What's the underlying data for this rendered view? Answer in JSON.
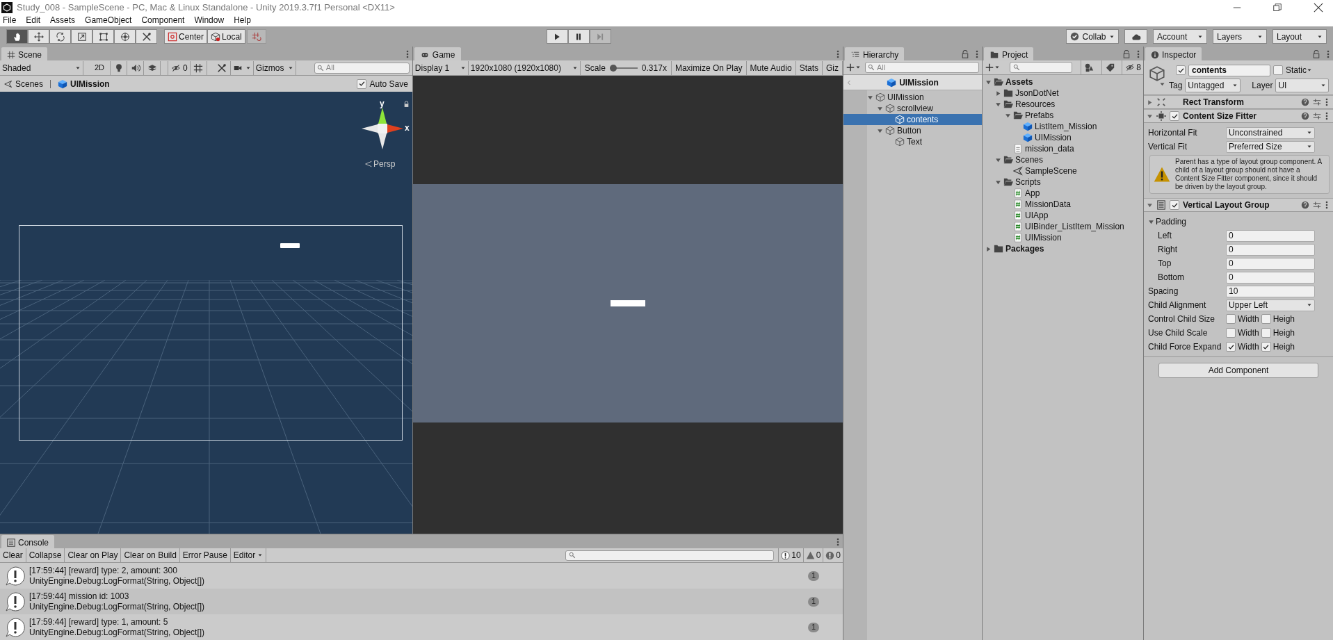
{
  "title_bar": {
    "title": "Study_008 - SampleScene - PC, Mac & Linux Standalone - Unity 2019.3.7f1 Personal <DX11>"
  },
  "menu_bar": [
    "File",
    "Edit",
    "Assets",
    "GameObject",
    "Component",
    "Window",
    "Help"
  ],
  "toolbar": {
    "tools": [
      {
        "kind": "hand",
        "selected": true
      },
      {
        "kind": "move",
        "selected": false
      },
      {
        "kind": "rotate",
        "selected": false
      },
      {
        "kind": "scale",
        "selected": false
      },
      {
        "kind": "rect",
        "selected": false
      },
      {
        "kind": "transform",
        "selected": false
      },
      {
        "kind": "custom",
        "selected": false
      }
    ],
    "pivot_buttons": [
      {
        "kind": "center",
        "label": "Center"
      },
      {
        "kind": "local",
        "label": "Local"
      }
    ],
    "play_controls": [
      {
        "kind": "play",
        "disabled": false
      },
      {
        "kind": "pause",
        "disabled": false
      },
      {
        "kind": "step",
        "disabled": true
      }
    ],
    "right_buttons": [
      {
        "kind": "collab",
        "label": "Collab"
      },
      {
        "kind": "cloud"
      },
      {
        "kind": "dropdown",
        "label": "Account"
      },
      {
        "kind": "dropdown",
        "label": "Layers"
      },
      {
        "kind": "dropdown",
        "label": "Layout"
      }
    ]
  },
  "scene_panel": {
    "tab": "Scene",
    "toolbar": {
      "shading": "Shaded",
      "mode_2d": "2D",
      "hidden_count": "0",
      "gizmos": "Gizmos",
      "search_placeholder": "All"
    },
    "breadcrumbs": [
      {
        "kind": "scenes",
        "label": "Scenes"
      },
      {
        "kind": "prefab",
        "label": "UIMission"
      }
    ],
    "auto_save": {
      "label": "Auto Save",
      "checked": true
    },
    "view": {
      "axis_y": "y",
      "axis_x": "x",
      "projection": "Persp"
    }
  },
  "game_panel": {
    "tab": "Game",
    "toolbar": {
      "display": "Display 1",
      "resolution": "1920x1080 (1920x1080)",
      "scale_label": "Scale",
      "scale": {
        "level": 0.12
      },
      "scale_reading": "0.317x",
      "buttons": [
        "Maximize On Play",
        "Mute Audio",
        "Stats",
        "Giz"
      ]
    }
  },
  "hierarchy": {
    "tab": "Hierarchy",
    "search_placeholder": "All",
    "header": "UIMission",
    "tree": [
      {
        "label": "UIMission",
        "expanded": true,
        "selected": false,
        "children": [
          {
            "label": "scrollview",
            "expanded": true,
            "selected": false,
            "children": [
              {
                "label": "contents",
                "selected": true
              }
            ]
          },
          {
            "label": "Button",
            "expanded": true,
            "selected": false,
            "children": [
              {
                "label": "Text",
                "selected": false
              }
            ]
          }
        ]
      }
    ]
  },
  "project": {
    "tab": "Project",
    "hidden_count": "8",
    "tree": [
      {
        "kind": "folder",
        "label": "Assets",
        "expanded": true,
        "children": [
          {
            "kind": "folder",
            "label": "JsonDotNet",
            "expanded": false
          },
          {
            "kind": "folder",
            "label": "Resources",
            "expanded": true,
            "children": [
              {
                "kind": "folder",
                "label": "Prefabs",
                "expanded": true,
                "children": [
                  {
                    "kind": "prefab",
                    "label": "ListItem_Mission"
                  },
                  {
                    "kind": "prefab",
                    "label": "UIMission"
                  }
                ]
              },
              {
                "kind": "text",
                "label": "mission_data"
              }
            ]
          },
          {
            "kind": "folder",
            "label": "Scenes",
            "expanded": true,
            "children": [
              {
                "kind": "scene",
                "label": "SampleScene"
              }
            ]
          },
          {
            "kind": "folder",
            "label": "Scripts",
            "expanded": true,
            "children": [
              {
                "kind": "script",
                "label": "App"
              },
              {
                "kind": "script",
                "label": "MissionData"
              },
              {
                "kind": "script",
                "label": "UIApp"
              },
              {
                "kind": "script",
                "label": "UIBinder_ListItem_Mission"
              },
              {
                "kind": "script",
                "label": "UIMission"
              }
            ]
          }
        ]
      },
      {
        "kind": "folder",
        "label": "Packages",
        "expanded": false
      }
    ]
  },
  "inspector": {
    "tab": "Inspector",
    "object": {
      "active": true,
      "name": "contents",
      "static_label": "Static",
      "static": false,
      "tag_label": "Tag",
      "tag": "Untagged",
      "layer_label": "Layer",
      "layer": "UI"
    },
    "components": [
      {
        "kind": "rect_transform",
        "title": "Rect Transform",
        "expanded": false
      },
      {
        "kind": "content_size_fitter",
        "title": "Content Size Fitter",
        "expanded": true,
        "enabled": true,
        "properties": [
          {
            "kind": "dropdown",
            "label": "Horizontal Fit",
            "value": "Unconstrained"
          },
          {
            "kind": "dropdown",
            "label": "Vertical Fit",
            "value": "Preferred Size"
          },
          {
            "kind": "warning",
            "text": "Parent has a type of layout group component. A child of a layout group should not have a Content Size Fitter component, since it should be driven by the layout group."
          }
        ]
      },
      {
        "kind": "vertical_layout_group",
        "title": "Vertical Layout Group",
        "expanded": true,
        "enabled": true,
        "properties": [
          {
            "kind": "foldout",
            "label": "Padding",
            "expanded": true,
            "children": [
              {
                "kind": "number",
                "label": "Left",
                "value": "0"
              },
              {
                "kind": "number",
                "label": "Right",
                "value": "0"
              },
              {
                "kind": "number",
                "label": "Top",
                "value": "0"
              },
              {
                "kind": "number",
                "label": "Bottom",
                "value": "0"
              }
            ]
          },
          {
            "kind": "number",
            "label": "Spacing",
            "value": "10"
          },
          {
            "kind": "dropdown",
            "label": "Child Alignment",
            "value": "Upper Left"
          },
          {
            "kind": "toggles",
            "label": "Control Child Size",
            "toggles": [
              {
                "label": "Width",
                "checked": false
              },
              {
                "label": "Heigh",
                "checked": false
              }
            ]
          },
          {
            "kind": "toggles",
            "label": "Use Child Scale",
            "toggles": [
              {
                "label": "Width",
                "checked": false
              },
              {
                "label": "Heigh",
                "checked": false
              }
            ]
          },
          {
            "kind": "toggles",
            "label": "Child Force Expand",
            "toggles": [
              {
                "label": "Width",
                "checked": true
              },
              {
                "label": "Heigh",
                "checked": true
              }
            ]
          }
        ]
      }
    ],
    "add_component": "Add Component"
  },
  "console": {
    "tab": "Console",
    "buttons": [
      "Clear",
      "Collapse",
      "Clear on Play",
      "Clear on Build",
      "Error Pause"
    ],
    "editor_dropdown": "Editor",
    "counts": [
      {
        "kind": "info",
        "count": "10"
      },
      {
        "kind": "warning",
        "count": "0"
      },
      {
        "kind": "error",
        "count": "0"
      }
    ],
    "entries": [
      {
        "message": "[17:59:44] [reward] type: 2, amount: 300",
        "trace": "UnityEngine.Debug:LogFormat(String, Object[])",
        "count": "1"
      },
      {
        "message": "[17:59:44] mission id: 1003",
        "trace": "UnityEngine.Debug:LogFormat(String, Object[])",
        "count": "1"
      },
      {
        "message": "[17:59:44] [reward] type: 1, amount: 5",
        "trace": "UnityEngine.Debug:LogFormat(String, Object[])",
        "count": "1"
      }
    ]
  }
}
